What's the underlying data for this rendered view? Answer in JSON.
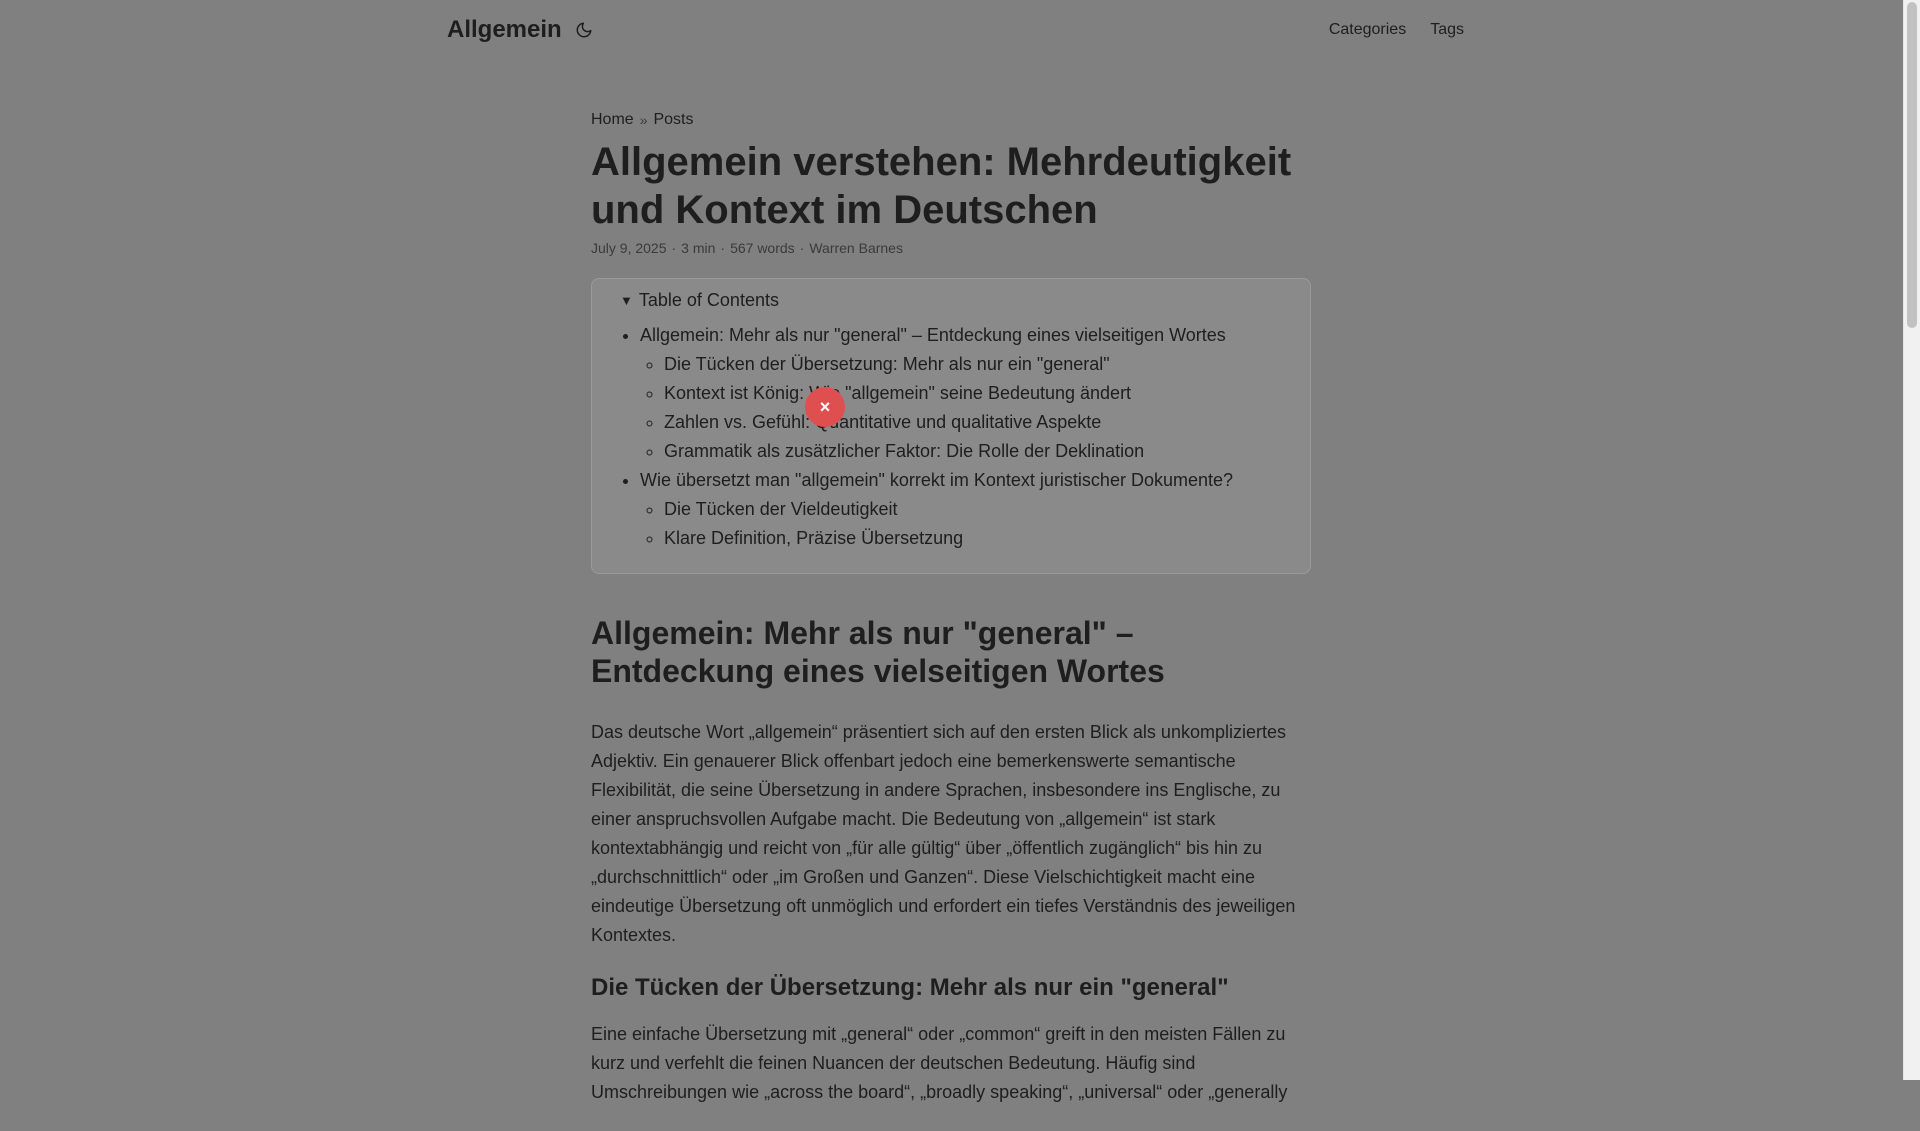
{
  "header": {
    "logo": "Allgemein",
    "theme_toggle_icon": "moon-icon",
    "menu": [
      {
        "label": "Categories"
      },
      {
        "label": "Tags"
      }
    ]
  },
  "breadcrumb": {
    "home": "Home",
    "separator": "»",
    "posts": "Posts"
  },
  "post": {
    "title": "Allgemein verstehen: Mehrdeutigkeit und Kontext im Deutschen",
    "meta": {
      "date": "July 9, 2025",
      "read_time": "3 min",
      "words": "567 words",
      "author": "Warren Barnes",
      "separator": "·"
    }
  },
  "toc": {
    "summary": "Table of Contents",
    "items": [
      {
        "label": "Allgemein: Mehr als nur \"general\" – Entdeckung eines vielseitigen Wortes",
        "children": [
          {
            "label": "Die Tücken der Übersetzung: Mehr als nur ein \"general\""
          },
          {
            "label": "Kontext ist König: Wie \"allgemein\" seine Bedeutung ändert"
          },
          {
            "label": "Zahlen vs. Gefühl: Quantitative und qualitative Aspekte"
          },
          {
            "label": "Grammatik als zusätzlicher Faktor: Die Rolle der Deklination"
          }
        ]
      },
      {
        "label": "Wie übersetzt man \"allgemein\" korrekt im Kontext juristischer Dokumente?",
        "children": [
          {
            "label": "Die Tücken der Vieldeutigkeit"
          },
          {
            "label": "Klare Definition, Präzise Übersetzung"
          }
        ]
      }
    ]
  },
  "content": {
    "h2": "Allgemein: Mehr als nur \"general\" – Entdeckung eines vielseitigen Wortes",
    "p1": "Das deutsche Wort „allgemein“ präsentiert sich auf den ersten Blick als unkompliziertes Adjektiv. Ein genauerer Blick offenbart jedoch eine bemerkenswerte semantische Flexibilität, die seine Übersetzung in andere Sprachen, insbesondere ins Englische, zu einer anspruchsvollen Aufgabe macht. Die Bedeutung von „allgemein“ ist stark kontextabhängig und reicht von „für alle gültig“ über „öffentlich zugänglich“ bis hin zu „durchschnittlich“ oder „im Großen und Ganzen“. Diese Vielschichtigkeit macht eine eindeutige Übersetzung oft unmöglich und erfordert ein tiefes Verständnis des jeweiligen Kontextes.",
    "h3": "Die Tücken der Übersetzung: Mehr als nur ein \"general\"",
    "p2": "Eine einfache Übersetzung mit „general“ oder „common“ greift in den meisten Fällen zu kurz und verfehlt die feinen Nuancen der deutschen Bedeutung. Häufig sind Umschreibungen wie „across the board“, „broadly speaking“, „universal“ oder „generally"
  },
  "overlay": {
    "close_label": "×"
  }
}
